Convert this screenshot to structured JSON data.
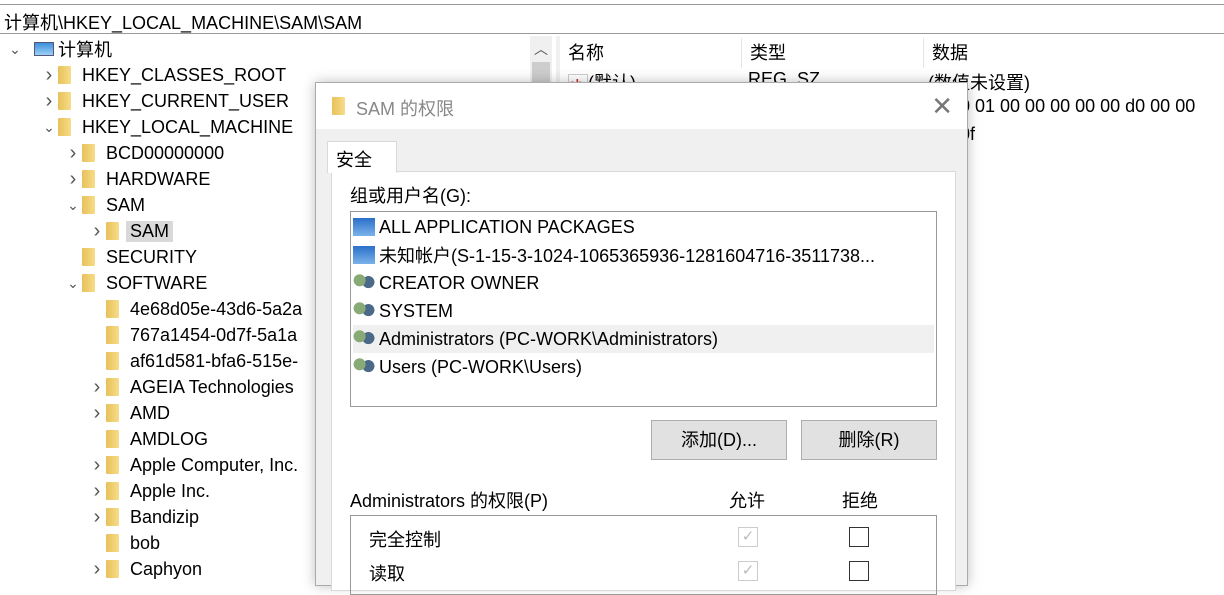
{
  "address": "计算机\\HKEY_LOCAL_MACHINE\\SAM\\SAM",
  "tree": [
    {
      "label": "计算机",
      "level": 0,
      "arrow": "expanded",
      "icon": "computer-icon"
    },
    {
      "label": "HKEY_CLASSES_ROOT",
      "level": 1,
      "arrow": "collapsed"
    },
    {
      "label": "HKEY_CURRENT_USER",
      "level": 1,
      "arrow": "collapsed"
    },
    {
      "label": "HKEY_LOCAL_MACHINE",
      "level": 1,
      "arrow": "expanded"
    },
    {
      "label": "BCD00000000",
      "level": 2,
      "arrow": "collapsed"
    },
    {
      "label": "HARDWARE",
      "level": 2,
      "arrow": "collapsed"
    },
    {
      "label": "SAM",
      "level": 2,
      "arrow": "expanded"
    },
    {
      "label": "SAM",
      "level": 3,
      "arrow": "collapsed",
      "selected": true
    },
    {
      "label": "SECURITY",
      "level": 2,
      "arrow": "none"
    },
    {
      "label": "SOFTWARE",
      "level": 2,
      "arrow": "expanded"
    },
    {
      "label": "4e68d05e-43d6-5a2a",
      "level": 3,
      "arrow": "none"
    },
    {
      "label": "767a1454-0d7f-5a1a",
      "level": 3,
      "arrow": "none"
    },
    {
      "label": "af61d581-bfa6-515e-",
      "level": 3,
      "arrow": "none"
    },
    {
      "label": "AGEIA Technologies",
      "level": 3,
      "arrow": "collapsed"
    },
    {
      "label": "AMD",
      "level": 3,
      "arrow": "collapsed"
    },
    {
      "label": "AMDLOG",
      "level": 3,
      "arrow": "none"
    },
    {
      "label": "Apple Computer, Inc.",
      "level": 3,
      "arrow": "collapsed"
    },
    {
      "label": "Apple Inc.",
      "level": 3,
      "arrow": "collapsed"
    },
    {
      "label": "Bandizip",
      "level": 3,
      "arrow": "collapsed"
    },
    {
      "label": "bob",
      "level": 3,
      "arrow": "none"
    },
    {
      "label": "Caphyon",
      "level": 3,
      "arrow": "collapsed"
    }
  ],
  "list": {
    "headers": [
      "名称",
      "类型",
      "数据"
    ],
    "rows": [
      {
        "name": "(默认)",
        "type": "REG_SZ",
        "data": "(数值未设置)"
      },
      {
        "name": "",
        "type": "",
        "data": "0 01 00 00 00 00 00 d0 00 00"
      },
      {
        "name": "",
        "type": "",
        "data": "0f"
      }
    ]
  },
  "dialog": {
    "title": "SAM 的权限",
    "tab": "安全",
    "group_label": "组或用户名(G):",
    "users": [
      {
        "name": "ALL APPLICATION PACKAGES",
        "icon": "app-package-icon"
      },
      {
        "name": "未知帐户(S-1-15-3-1024-1065365936-1281604716-3511738...",
        "icon": "app-package-icon"
      },
      {
        "name": "CREATOR OWNER",
        "icon": "users-icon"
      },
      {
        "name": "SYSTEM",
        "icon": "users-icon"
      },
      {
        "name": "Administrators (PC-WORK\\Administrators)",
        "icon": "users-icon",
        "selected": true
      },
      {
        "name": "Users (PC-WORK\\Users)",
        "icon": "users-icon"
      }
    ],
    "add_button": "添加(D)...",
    "remove_button": "删除(R)",
    "perm_label": "Administrators 的权限(P)",
    "allow_header": "允许",
    "deny_header": "拒绝",
    "permissions": [
      {
        "name": "完全控制",
        "allow": true,
        "allow_disabled": true,
        "deny": false
      },
      {
        "name": "读取",
        "allow": true,
        "allow_disabled": true,
        "deny": false
      }
    ]
  }
}
